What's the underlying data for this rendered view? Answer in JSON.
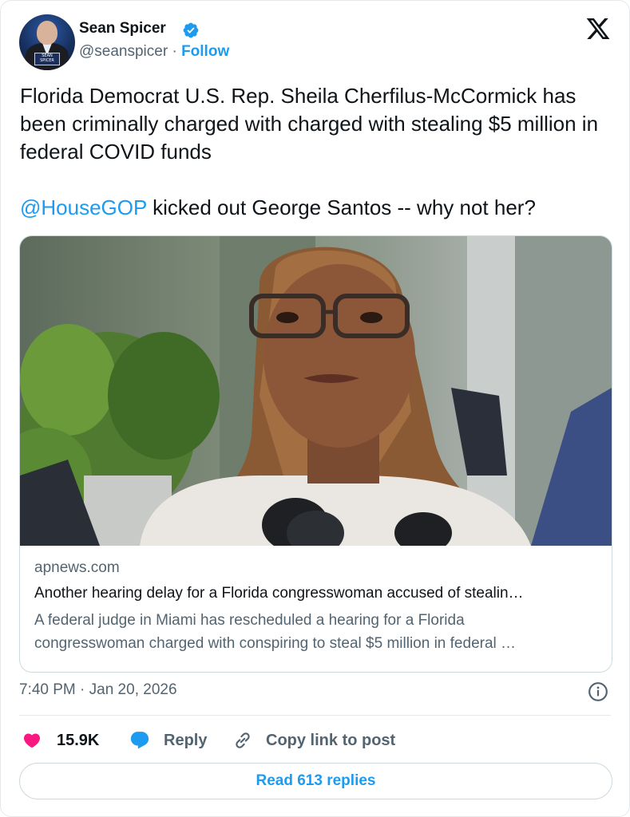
{
  "author": {
    "name": "Sean Spicer",
    "handle": "@seanspicer",
    "separator": "·",
    "follow_label": "Follow",
    "avatar_logo_text": "SEAN SPICER"
  },
  "tweet": {
    "paragraph1": "Florida Democrat U.S. Rep. Sheila Cherfilus-McCormick has been criminally charged with charged with stealing $5 million in federal COVID funds",
    "mention": "@HouseGOP",
    "paragraph2_rest": " kicked out George Santos -- why not her?"
  },
  "link_card": {
    "domain": "apnews.com",
    "title": "Another hearing delay for a Florida congresswoman accused of stealin…",
    "description_line1": "A federal judge in Miami has rescheduled a hearing for a Florida",
    "description_line2": "congresswoman charged with conspiring to steal $5 million in federal …"
  },
  "meta": {
    "timestamp": "7:40 PM · Jan 20, 2026"
  },
  "actions": {
    "like_count": "15.9K",
    "reply_label": "Reply",
    "copy_label": "Copy link to post"
  },
  "read_replies_label": "Read 613 replies",
  "colors": {
    "accent": "#1d9bf0",
    "like": "#f91880",
    "text": "#0f1419",
    "muted": "#536471"
  },
  "icons": [
    "verified-badge-icon",
    "x-logo-icon",
    "info-icon",
    "heart-icon",
    "reply-bubble-icon",
    "link-icon"
  ]
}
